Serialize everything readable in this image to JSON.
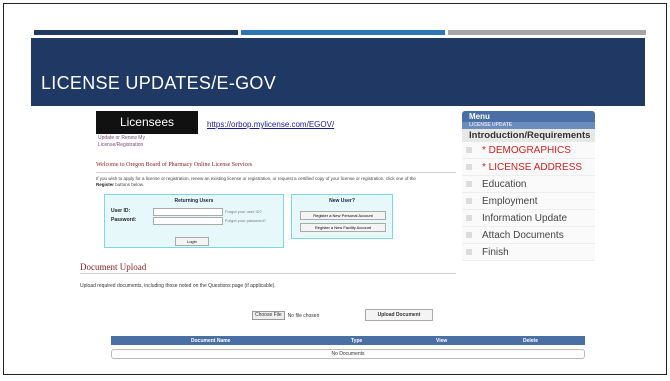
{
  "slide": {
    "title": "LICENSE UPDATES/E-GOV",
    "bar_colors": [
      "#1f3864",
      "#2e75b6",
      "#a6a6a6"
    ]
  },
  "portal": {
    "licensees_label": "Licensees",
    "licensees_sub": "Update or Renew My License/Registration",
    "url": "https://orbop.mylicense.com/EGOV/",
    "welcome": "Welcome to Oregon Board of Pharmacy Online License Services",
    "intro": "If you wish to apply for a license or registration, renew an existing license or registration, or request a certified copy of your license or registration, click one of the",
    "intro_bold": "Register",
    "intro_tail": "buttons below.",
    "returning_users": {
      "header": "Returning Users",
      "userid_label": "User ID:",
      "password_label": "Password:",
      "forgot_userid": "Forgot your user ID?",
      "forgot_password": "Forgot your password?",
      "login": "Login"
    },
    "new_user": {
      "header": "New User?",
      "personal": "Register a New Personal Account",
      "facility": "Register a New Facility Account"
    }
  },
  "menu": {
    "header": "Menu",
    "sub": "LICENSE UPDATE",
    "intro": "Introduction/Requirements",
    "items": [
      {
        "label": "* DEMOGRAPHICS",
        "color": "red"
      },
      {
        "label": "* LICENSE ADDRESS",
        "color": "red"
      },
      {
        "label": "Education",
        "color": "normal"
      },
      {
        "label": "Employment",
        "color": "normal"
      },
      {
        "label": "Information Update",
        "color": "normal"
      },
      {
        "label": "Attach Documents",
        "color": "normal"
      },
      {
        "label": "Finish",
        "color": "normal"
      }
    ]
  },
  "upload": {
    "heading": "Document Upload",
    "instructions": "Upload required documents, including those noted on the Questions page (if applicable).",
    "choose_file": "Choose File",
    "no_file": "No file chosen",
    "upload_button": "Upload Document",
    "columns": [
      "Document Name",
      "Type",
      "View",
      "Delete"
    ],
    "empty": "No Documents"
  }
}
